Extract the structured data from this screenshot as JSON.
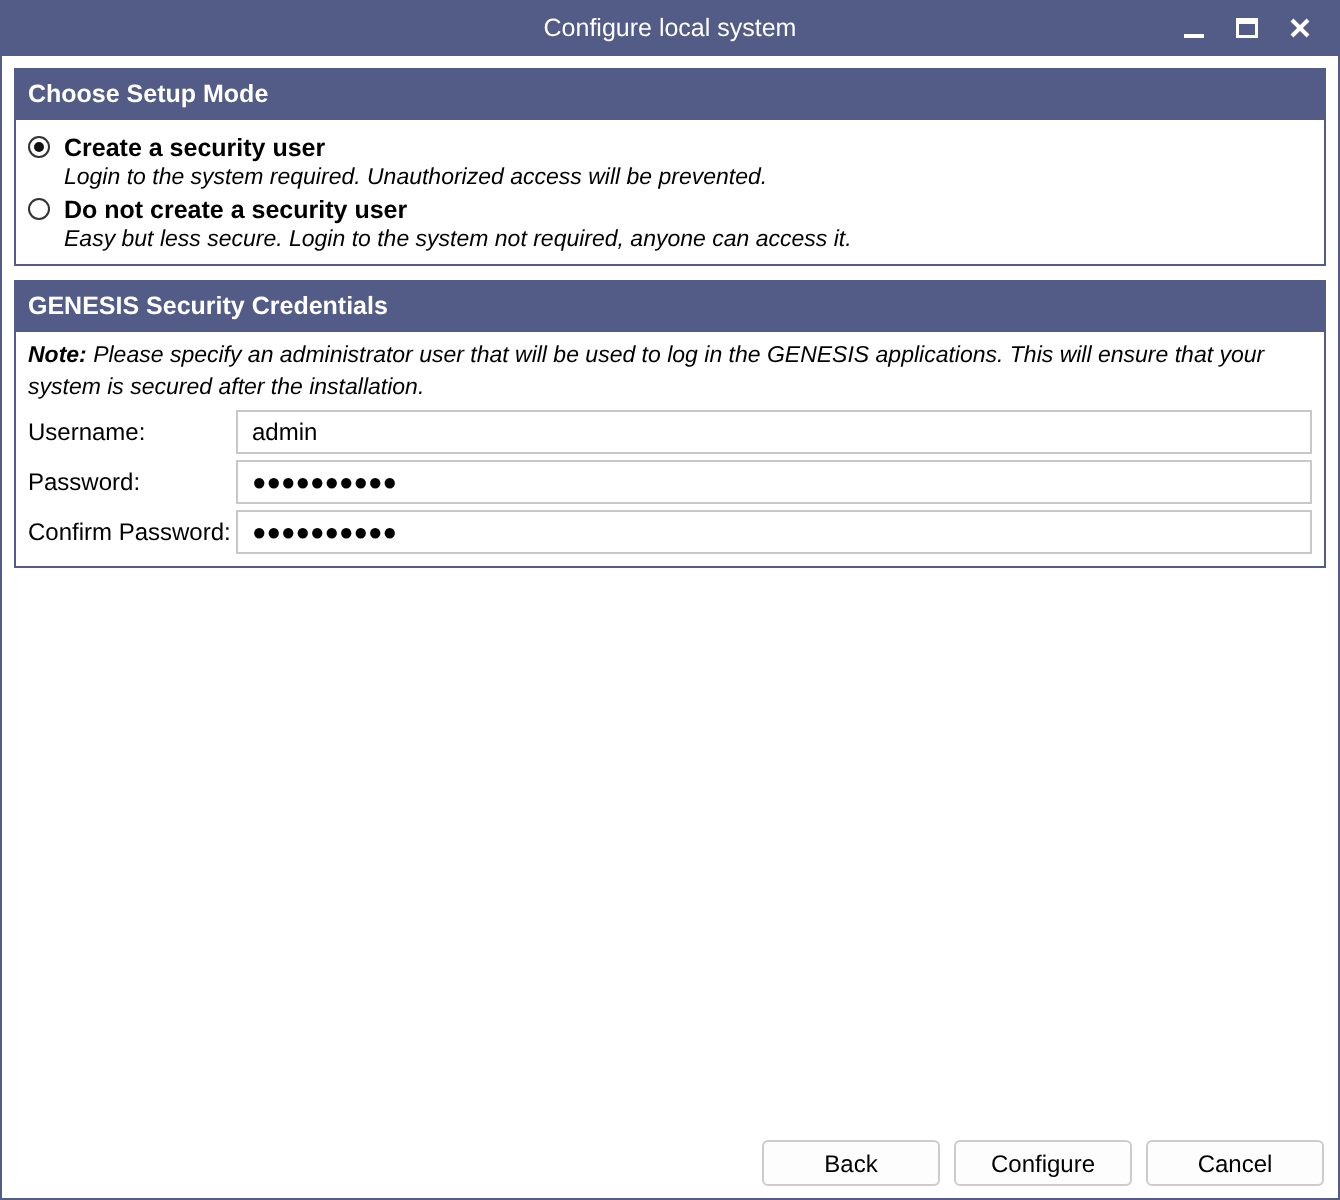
{
  "window": {
    "title": "Configure local system"
  },
  "setup_mode": {
    "title": "Choose Setup Mode",
    "options": [
      {
        "label": "Create a security user",
        "description": "Login to the system required. Unauthorized access will be prevented.",
        "selected": true
      },
      {
        "label": "Do not create a security user",
        "description": "Easy but less secure. Login to the system not required, anyone can access it.",
        "selected": false
      }
    ]
  },
  "credentials": {
    "title": "GENESIS Security Credentials",
    "note": "**Note:** Please specify an administrator user that will be used to log in the GENESIS applications. This will ensure that your system is secured after the installation.",
    "fields": [
      {
        "label": "Username:",
        "value": "admin"
      },
      {
        "label": "Password:",
        "value": "●●●●●●●●●●"
      },
      {
        "label": "Confirm Password:",
        "value": "●●●●●●●●●●"
      }
    ]
  },
  "buttons": [
    "Back",
    "Configure",
    "Cancel"
  ]
}
